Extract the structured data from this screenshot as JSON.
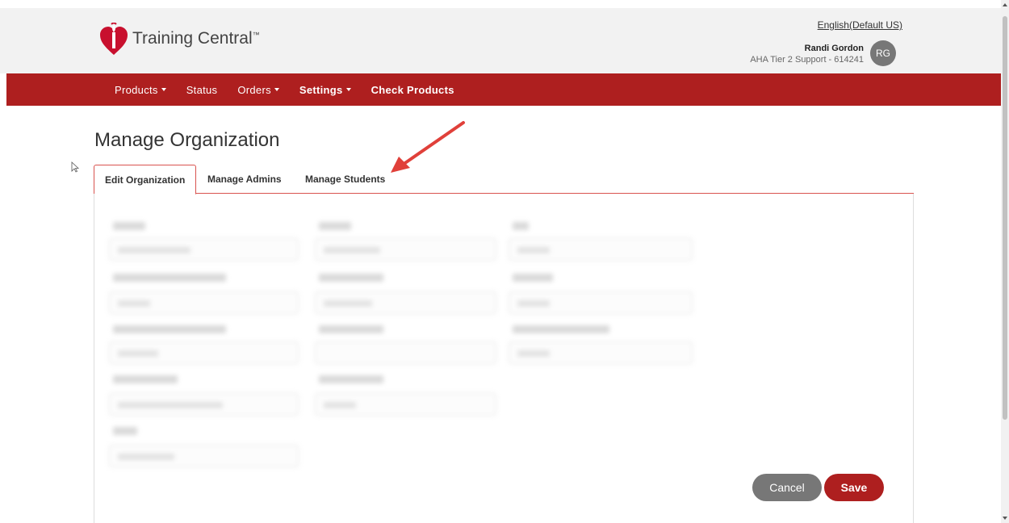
{
  "header": {
    "logo_text": "Training Central",
    "logo_tm": "™",
    "language": "English(Default US)",
    "user_name": "Randi Gordon",
    "user_role": "AHA Tier 2 Support - 614241",
    "avatar_initials": "RG"
  },
  "nav": {
    "products": "Products",
    "status": "Status",
    "orders": "Orders",
    "settings": "Settings",
    "check_products": "Check Products"
  },
  "page": {
    "title": "Manage Organization"
  },
  "tabs": [
    {
      "label": "Edit Organization",
      "active": true
    },
    {
      "label": "Manage Admins",
      "active": false
    },
    {
      "label": "Manage Students",
      "active": false
    }
  ],
  "actions": {
    "cancel": "Cancel",
    "save": "Save"
  },
  "colors": {
    "brand_red": "#ae1f1f",
    "cancel_gray": "#777777",
    "annotation_red": "#e0403a"
  },
  "icons": {
    "logo": "aha-heart-torch-icon",
    "cursor": "mouse-pointer-icon",
    "annotation": "red-arrow-icon"
  }
}
